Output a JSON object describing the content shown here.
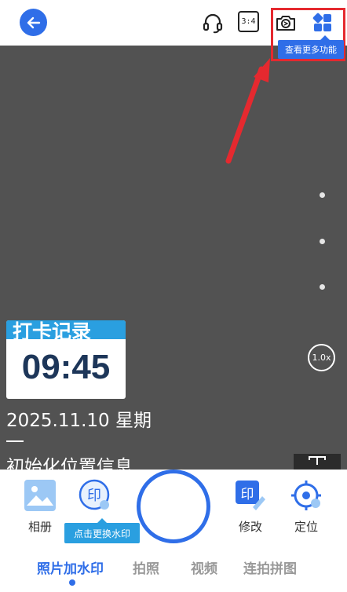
{
  "header": {
    "ratio_label": "3:4",
    "tooltip": "查看更多功能",
    "icons": [
      "back-arrow-icon",
      "headset-icon",
      "aspect-ratio-icon",
      "camera-switch-icon",
      "grid-apps-icon"
    ],
    "colors": {
      "accent": "#2f6ee8",
      "highlight": "#e5292f"
    }
  },
  "viewfinder": {
    "zoom_label": "1.0x",
    "watermark": {
      "title": "打卡记录",
      "time": "09:45",
      "date": "2025.11.10 星期",
      "location": "初始化位置信息"
    }
  },
  "tools": {
    "album": "相册",
    "change_watermark_tip": "点击更换水印",
    "edit": "修改",
    "locate": "定位"
  },
  "modes": [
    {
      "label": "照片加水印",
      "active": true
    },
    {
      "label": "拍照",
      "active": false
    },
    {
      "label": "视频",
      "active": false
    },
    {
      "label": "连拍拼图",
      "active": false
    }
  ]
}
